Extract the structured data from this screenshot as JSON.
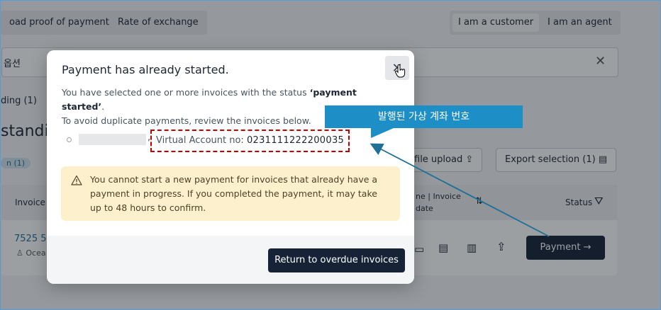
{
  "background": {
    "top_buttons": [
      "oad proof of payment",
      "Rate of exchange"
    ],
    "role_toggle": {
      "customer": "I am a customer",
      "agent": "I am an agent"
    },
    "search_text": "옵션",
    "tab_label": "ding (1)",
    "heading": "standin",
    "chip": "n (1)",
    "file_upload_label": "file upload",
    "export_label": "Export selection (1)",
    "col_invoice": "Invoice n",
    "col_date_line1": "ne | Invoice",
    "col_date_line2": "date",
    "col_status": "Status",
    "row_invoice": "7525 5",
    "row_customer": "Ocea",
    "payment_label": "Payment"
  },
  "modal": {
    "title": "Payment has already started.",
    "desc_line1_prefix": "You have selected one or more invoices with the status ",
    "desc_status": "‘payment started’",
    "desc_line1_suffix": ".",
    "desc_line2": "To avoid duplicate payments, review the invoices below.",
    "comma": ",",
    "va_label": "Virtual Account no:",
    "va_number": "0231111222200035",
    "warning": "You cannot start a new payment for invoices that already have a payment in progress. If you completed the payment, it may take up to 48 hours to confirm.",
    "return_button": "Return to overdue invoices"
  },
  "annotation": {
    "callout_text": "발행된 가상 계좌 번호",
    "color": "#1e8ec7",
    "highlight_color": "#c00000"
  }
}
